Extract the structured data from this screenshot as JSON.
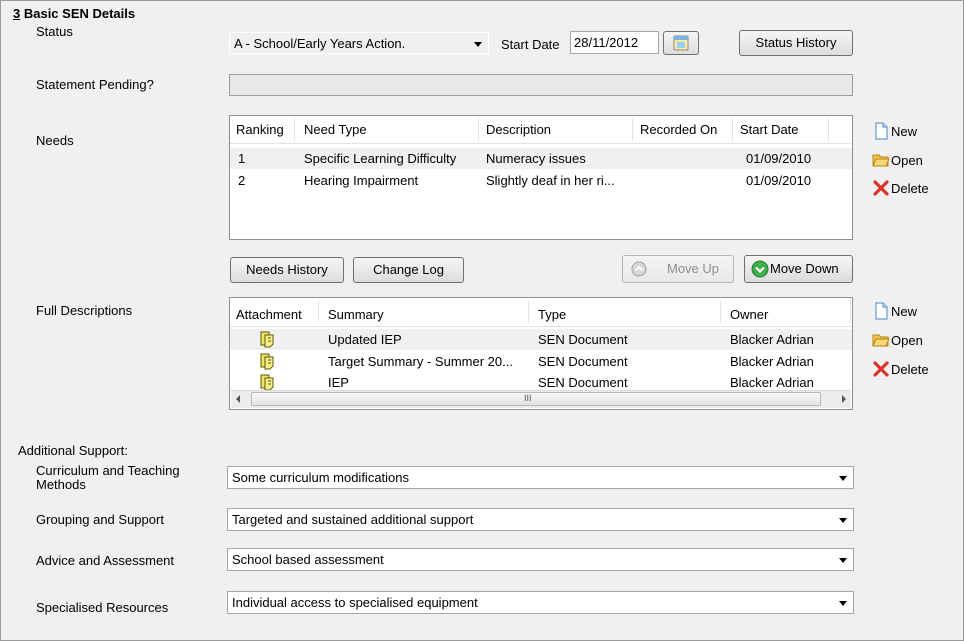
{
  "section": {
    "number": "3",
    "title": " Basic SEN Details"
  },
  "status": {
    "label": "Status",
    "value": "A - School/Early Years Action."
  },
  "start_date": {
    "label": "Start Date",
    "value": "28/11/2012"
  },
  "status_history_label": "Status History",
  "statement_pending": {
    "label": "Statement Pending?",
    "value": ""
  },
  "needs": {
    "label": "Needs",
    "columns": [
      "Ranking",
      "Need Type",
      "Description",
      "Recorded On",
      "Start Date"
    ],
    "rows": [
      [
        "1",
        "Specific Learning Difficulty",
        "Numeracy issues",
        "",
        "01/09/2010"
      ],
      [
        "2",
        "Hearing Impairment",
        "Slightly deaf in her ri...",
        "",
        "01/09/2010"
      ]
    ],
    "actions": {
      "new": "New",
      "open": "Open",
      "delete": "Delete"
    },
    "buttons": {
      "needs_history": "Needs History",
      "change_log": "Change Log",
      "move_up": "Move Up",
      "move_down": "Move Down"
    }
  },
  "full_descriptions": {
    "label": "Full Descriptions",
    "columns": [
      "Attachment",
      "Summary",
      "Type",
      "Owner"
    ],
    "rows": [
      [
        "",
        "Updated IEP",
        "SEN Document",
        "Blacker Adrian"
      ],
      [
        "",
        "Target Summary - Summer 20...",
        "SEN Document",
        "Blacker Adrian"
      ],
      [
        "",
        "IEP",
        "SEN Document",
        "Blacker Adrian"
      ]
    ],
    "actions": {
      "new": "New",
      "open": "Open",
      "delete": "Delete"
    },
    "scroll_grip": "III"
  },
  "additional_support": {
    "label": "Additional Support:",
    "fields": [
      {
        "label": "Curriculum and Teaching Methods",
        "value": "Some curriculum modifications"
      },
      {
        "label": "Grouping and Support",
        "value": "Targeted and sustained additional support"
      },
      {
        "label": "Advice and Assessment",
        "value": "School based assessment"
      },
      {
        "label": "Specialised Resources",
        "value": "Individual access to specialised equipment"
      }
    ]
  },
  "icons": [
    "calendar-icon",
    "new-document-icon",
    "open-folder-icon",
    "delete-x-icon",
    "move-up-arrow-icon",
    "move-down-arrow-icon",
    "attachment-icon"
  ]
}
